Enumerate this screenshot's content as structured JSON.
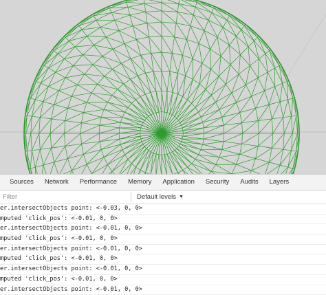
{
  "scene": {
    "wire_color": "#2e9a2e",
    "background_color": "#d6d6d6"
  },
  "devtools": {
    "tabs": [
      {
        "label": "Sources"
      },
      {
        "label": "Network"
      },
      {
        "label": "Performance"
      },
      {
        "label": "Memory"
      },
      {
        "label": "Application"
      },
      {
        "label": "Security"
      },
      {
        "label": "Audits"
      },
      {
        "label": "Layers"
      }
    ],
    "filter": {
      "placeholder": "Filter",
      "value": ""
    },
    "levels": {
      "label": "Default levels",
      "caret": "▼"
    },
    "console_lines": [
      "er.intersectObjects point: <-0.03, 0, 0>",
      "mputed 'click_pos': <-0.01, 0, 0>",
      "er.intersectObjects point: <-0.01, 0, 0>",
      "mputed 'click_pos': <-0.01, 0, 0>",
      "er.intersectObjects point: <-0.01, 0, 0>",
      "mputed 'click_pos': <-0.01, 0, 0>",
      "er.intersectObjects point: <-0.01, 0, 0>",
      "mputed 'click_pos': <-0.01, 0, 0>",
      "er.intersectObjects point: <-0.01, 0, 0>"
    ]
  }
}
